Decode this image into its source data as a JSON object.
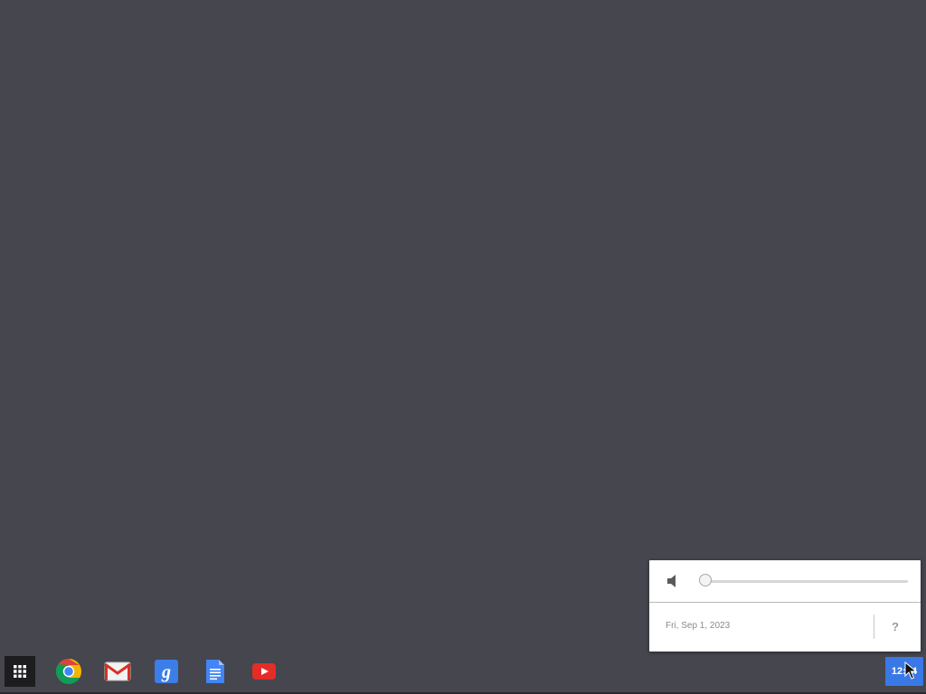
{
  "shelf": {
    "launcher": {
      "icon": "app-launcher-grid-icon"
    },
    "apps": [
      {
        "name": "Chrome",
        "icon": "chrome-icon"
      },
      {
        "name": "Gmail",
        "icon": "gmail-icon"
      },
      {
        "name": "Google Search",
        "icon": "google-search-icon"
      },
      {
        "name": "Docs",
        "icon": "docs-icon"
      },
      {
        "name": "YouTube",
        "icon": "youtube-icon"
      }
    ]
  },
  "status_area": {
    "time": "12:44",
    "color": "#3a78e6"
  },
  "tray_bubble": {
    "volume": {
      "icon": "speaker-muted-icon",
      "level": 0.0
    },
    "date": "Fri, Sep 1, 2023",
    "help_label": "?"
  },
  "colors": {
    "desktop_background": "#45464e",
    "accent": "#4a8af4"
  }
}
